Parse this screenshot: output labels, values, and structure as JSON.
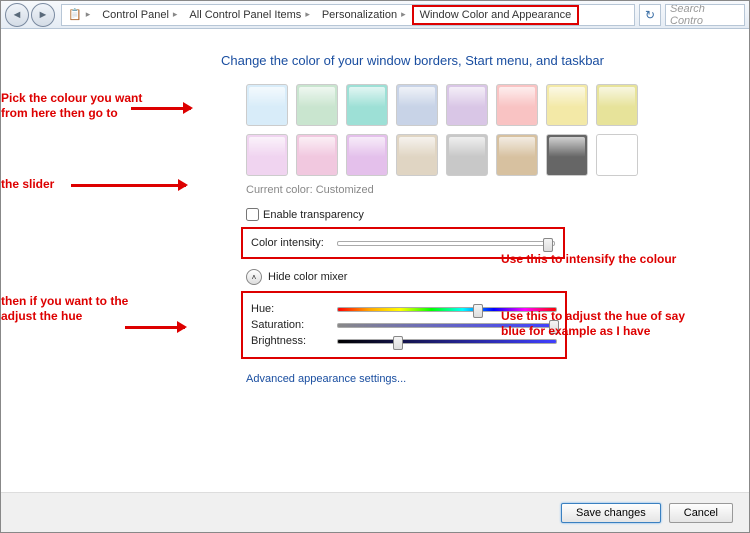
{
  "nav": {
    "crumbs": [
      "Control Panel",
      "All Control Panel Items",
      "Personalization",
      "Window Color and Appearance"
    ],
    "search_placeholder": "Search Contro"
  },
  "heading": "Change the color of your window borders, Start menu, and taskbar",
  "swatches": [
    "#d8ecf9",
    "#c9e5cf",
    "#9de0d6",
    "#c8d3e7",
    "#d9c6e6",
    "#f9c3c3",
    "#f3e9a7",
    "#e7e39a",
    "#f0d4f0",
    "#f1c8df",
    "#e4c0eb",
    "#e0d5c3",
    "#c8c8c8",
    "#d7c1a0",
    "#666666",
    "#ffffff"
  ],
  "current_color": {
    "label": "Current color:",
    "value": "Customized"
  },
  "transparency": {
    "label": "Enable transparency",
    "checked": false
  },
  "intensity": {
    "label": "Color intensity:",
    "pos": 95
  },
  "mixer_toggle": "Hide color mixer",
  "mixer": {
    "hue": {
      "label": "Hue:",
      "pos": 62
    },
    "sat": {
      "label": "Saturation:",
      "pos": 97
    },
    "bri": {
      "label": "Brightness:",
      "pos": 25
    }
  },
  "adv_link": "Advanced appearance settings...",
  "buttons": {
    "save": "Save changes",
    "cancel": "Cancel"
  },
  "annotations": {
    "a1": "Pick the colour you want from here then go to",
    "a2": "the slider",
    "a3": "then if you want to the adjust the hue",
    "a4": "Use this to intensify the colour",
    "a5": "Use this to adjust the hue of say blue for example as I have"
  }
}
